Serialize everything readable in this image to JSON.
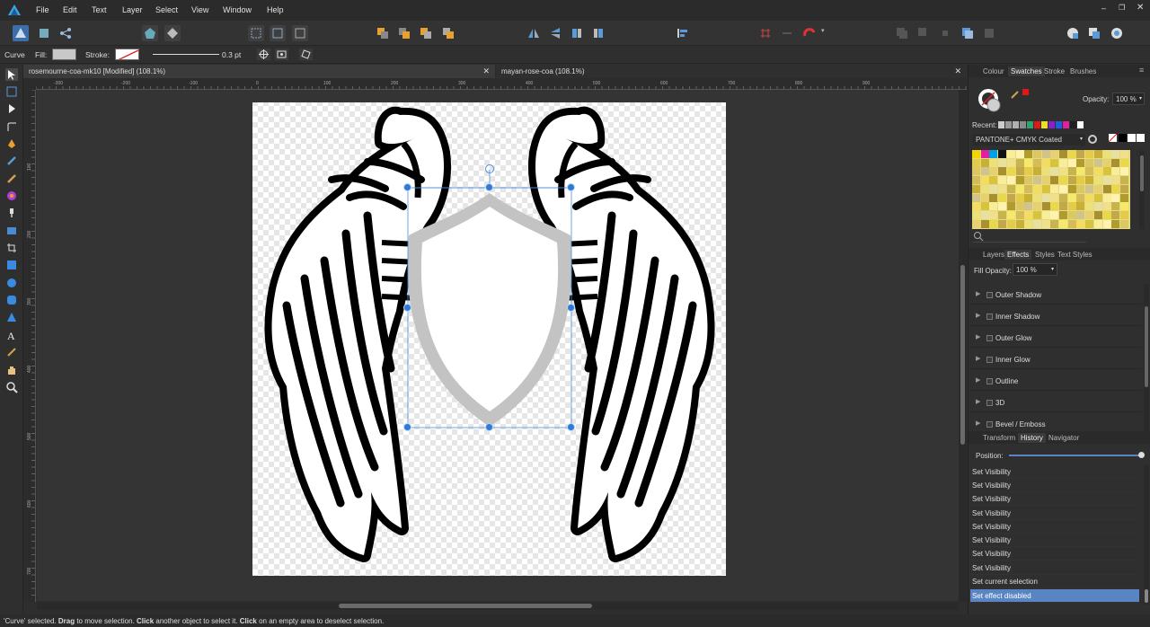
{
  "menu": {
    "items": [
      "File",
      "Edit",
      "Text",
      "Layer",
      "Select",
      "View",
      "Window",
      "Help"
    ]
  },
  "context_toolbar": {
    "tool_name": "Curve",
    "fill_label": "Fill:",
    "stroke_label": "Stroke:",
    "stroke_width": "0.3 pt"
  },
  "tabs": [
    {
      "label": "rosemourne-coa-mk10 [Modified] (108.1%)"
    },
    {
      "label": "mayan-rose-coa (108.1%)"
    }
  ],
  "ruler_top": [
    "-300",
    "-200",
    "-100",
    "0",
    "100",
    "200",
    "300",
    "400",
    "500",
    "600",
    "700",
    "800",
    "900"
  ],
  "ruler_left": [
    "100",
    "200",
    "300",
    "400",
    "500",
    "600",
    "700"
  ],
  "colour_panel": {
    "tabs": [
      "Colour",
      "Swatches",
      "Stroke",
      "Brushes"
    ],
    "active_tab": "Swatches",
    "opacity_label": "Opacity:",
    "opacity_value": "100 %",
    "recent_label": "Recent:",
    "palette_name": "PANTONE+ CMYK Coated"
  },
  "effects_panel": {
    "tabs": [
      "Layers",
      "Effects",
      "Styles",
      "Text Styles"
    ],
    "active_tab": "Effects",
    "fill_opacity_label": "Fill Opacity:",
    "fill_opacity_value": "100 %",
    "effects": [
      "Outer Shadow",
      "Inner Shadow",
      "Outer Glow",
      "Inner Glow",
      "Outline",
      "3D",
      "Bevel / Emboss"
    ]
  },
  "history_panel": {
    "tabs": [
      "Transform",
      "History",
      "Navigator"
    ],
    "active_tab": "History",
    "position_label": "Position:",
    "items": [
      "Set Visibility",
      "Set Visibility",
      "Set Visibility",
      "Set Visibility",
      "Set Visibility",
      "Set Visibility",
      "Set Visibility",
      "Set Visibility",
      "Set current selection",
      "Set effect disabled"
    ],
    "selected_index": 9
  },
  "status": {
    "p1": "'Curve' selected. ",
    "b1": "Drag",
    "p2": " to move selection. ",
    "b2": "Click",
    "p3": " another object to select it. ",
    "b3": "Click",
    "p4": " on an empty area to deselect selection."
  },
  "colors": {
    "accent": "#4a90d9",
    "selection_row": "#5a85c4",
    "stroke_swatch_slash": "#e02020",
    "recent_swatches": [
      "#cccccc",
      "#999999",
      "#b0b0b0",
      "#8a8a8a",
      "#2fa36f",
      "#e01818",
      "#e8e020",
      "#8a20c8",
      "#1e60e0",
      "#e020a0",
      "#202020",
      "#ffffff"
    ]
  }
}
